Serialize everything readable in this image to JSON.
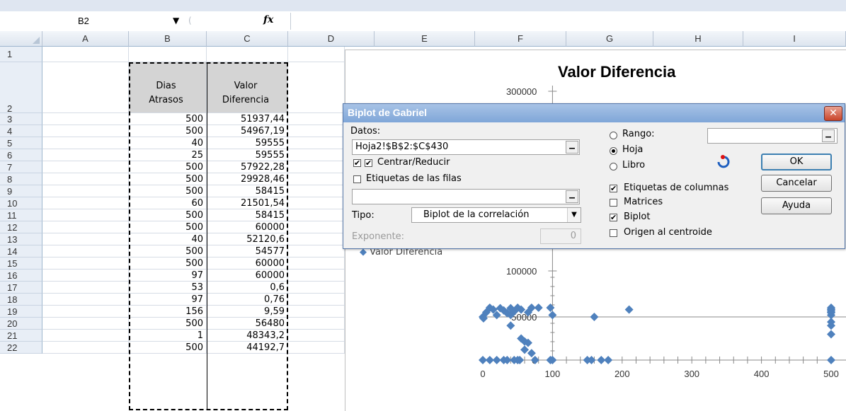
{
  "formula_bar": {
    "name_box": "B2",
    "fx_label": "fx"
  },
  "columns": [
    "A",
    "B",
    "C",
    "D",
    "E",
    "F",
    "G",
    "H",
    "I"
  ],
  "rows": [
    {
      "n": "1",
      "b": "",
      "c": ""
    },
    {
      "n": "2",
      "b1": "Dias",
      "b2": "Atrasos",
      "c1": "Valor",
      "c2": "Diferencia"
    },
    {
      "n": "3",
      "b": "500",
      "c": "51937,44"
    },
    {
      "n": "4",
      "b": "500",
      "c": "54967,19"
    },
    {
      "n": "5",
      "b": "40",
      "c": "59555"
    },
    {
      "n": "6",
      "b": "25",
      "c": "59555"
    },
    {
      "n": "7",
      "b": "500",
      "c": "57922,28"
    },
    {
      "n": "8",
      "b": "500",
      "c": "29928,46"
    },
    {
      "n": "9",
      "b": "500",
      "c": "58415"
    },
    {
      "n": "10",
      "b": "60",
      "c": "21501,54"
    },
    {
      "n": "11",
      "b": "500",
      "c": "58415"
    },
    {
      "n": "12",
      "b": "500",
      "c": "60000"
    },
    {
      "n": "13",
      "b": "40",
      "c": "52120,6"
    },
    {
      "n": "14",
      "b": "500",
      "c": "54577"
    },
    {
      "n": "15",
      "b": "500",
      "c": "60000"
    },
    {
      "n": "16",
      "b": "97",
      "c": "60000"
    },
    {
      "n": "17",
      "b": "53",
      "c": "0,6"
    },
    {
      "n": "18",
      "b": "97",
      "c": "0,76"
    },
    {
      "n": "19",
      "b": "156",
      "c": "9,59"
    },
    {
      "n": "20",
      "b": "500",
      "c": "56480"
    },
    {
      "n": "21",
      "b": "1",
      "c": "48343,2"
    },
    {
      "n": "22",
      "b": "500",
      "c": "44192,7"
    }
  ],
  "chart": {
    "title": "Valor Diferencia",
    "legend": "Valor Diferencia",
    "y_ticks_visible": [
      "300000",
      "100000",
      "50000",
      "0"
    ],
    "x_ticks": [
      "0",
      "100",
      "200",
      "300",
      "400",
      "500"
    ]
  },
  "chart_data": {
    "type": "scatter",
    "title": "Valor Diferencia",
    "series": [
      {
        "name": "Valor Diferencia",
        "points": [
          [
            0,
            50000
          ],
          [
            5,
            55000
          ],
          [
            10,
            60000
          ],
          [
            15,
            58000
          ],
          [
            20,
            52000
          ],
          [
            25,
            59555
          ],
          [
            30,
            57000
          ],
          [
            35,
            54000
          ],
          [
            40,
            59555
          ],
          [
            40,
            52120
          ],
          [
            45,
            56000
          ],
          [
            50,
            60000
          ],
          [
            55,
            58000
          ],
          [
            60,
            21501
          ],
          [
            65,
            55000
          ],
          [
            70,
            60000
          ],
          [
            80,
            60000
          ],
          [
            97,
            60000
          ],
          [
            100,
            52000
          ],
          [
            160,
            50000
          ],
          [
            210,
            58000
          ],
          [
            500,
            51937
          ],
          [
            500,
            54967
          ],
          [
            500,
            57922
          ],
          [
            500,
            29928
          ],
          [
            500,
            58415
          ],
          [
            500,
            60000
          ],
          [
            500,
            54577
          ],
          [
            500,
            56480
          ],
          [
            500,
            44192
          ],
          [
            500,
            40000
          ],
          [
            53,
            0.6
          ],
          [
            97,
            0.76
          ],
          [
            156,
            9.59
          ],
          [
            1,
            48343
          ],
          [
            20,
            0
          ],
          [
            35,
            0
          ],
          [
            40,
            40000
          ],
          [
            55,
            25000
          ],
          [
            60,
            12000
          ],
          [
            65,
            20000
          ],
          [
            70,
            8000
          ],
          [
            45,
            0
          ],
          [
            0,
            0
          ],
          [
            10,
            0
          ],
          [
            30,
            0
          ],
          [
            50,
            0
          ],
          [
            75,
            0
          ],
          [
            100,
            0
          ],
          [
            150,
            0
          ],
          [
            170,
            0
          ],
          [
            180,
            0
          ],
          [
            500,
            0
          ]
        ]
      }
    ],
    "xlim": [
      0,
      500
    ],
    "y_ticks_visible": [
      0,
      50000,
      100000,
      300000
    ]
  },
  "dialog": {
    "title": "Biplot de Gabriel",
    "datos_label": "Datos:",
    "datos_value": "Hoja2!$B$2:$C$430",
    "centrar_label": "Centrar/Reducir",
    "etiq_filas_label": "Etiquetas de las filas",
    "tipo_label": "Tipo:",
    "tipo_value": "Biplot de la correlación",
    "exponente_label": "Exponente:",
    "exponente_value": "0",
    "rango_label": "Rango:",
    "hoja_label": "Hoja",
    "libro_label": "Libro",
    "etiq_col_label": "Etiquetas de columnas",
    "matrices_label": "Matrices",
    "biplot_label": "Biplot",
    "origen_label": "Origen al centroide",
    "ok_label": "OK",
    "cancel_label": "Cancelar",
    "help_label": "Ayuda",
    "checked_mark": "✔",
    "browse_mark": "…",
    "close_mark": "✕",
    "dropdown_mark": "▼"
  }
}
